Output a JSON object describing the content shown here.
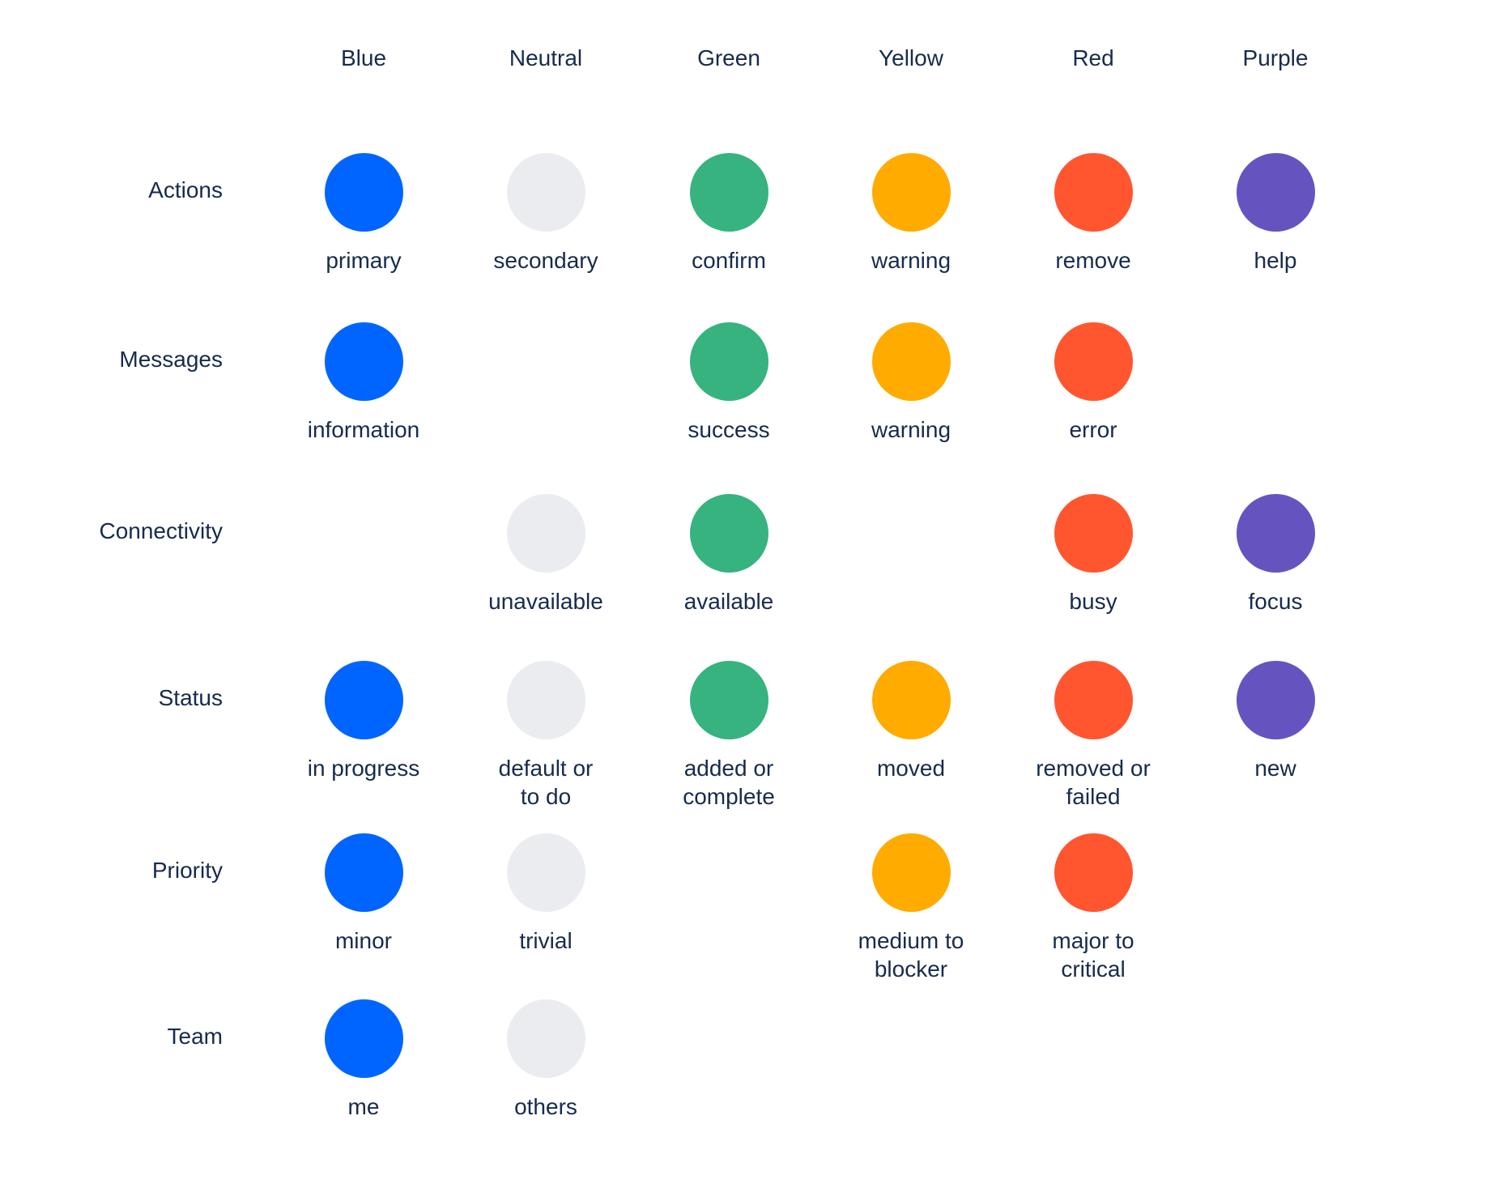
{
  "colors": {
    "blue": "#0065ff",
    "neutral": "#ebecf0",
    "green": "#36b37e",
    "yellow": "#ffab00",
    "red": "#ff5630",
    "purple": "#6554c0"
  },
  "columns": [
    "Blue",
    "Neutral",
    "Green",
    "Yellow",
    "Red",
    "Purple"
  ],
  "rows": [
    {
      "label": "Actions",
      "cells": [
        {
          "col": 0,
          "color": "blue",
          "label": "primary"
        },
        {
          "col": 1,
          "color": "neutral",
          "label": "secondary"
        },
        {
          "col": 2,
          "color": "green",
          "label": "confirm"
        },
        {
          "col": 3,
          "color": "yellow",
          "label": "warning"
        },
        {
          "col": 4,
          "color": "red",
          "label": "remove"
        },
        {
          "col": 5,
          "color": "purple",
          "label": "help"
        }
      ]
    },
    {
      "label": "Messages",
      "cells": [
        {
          "col": 0,
          "color": "blue",
          "label": "information"
        },
        {
          "col": 2,
          "color": "green",
          "label": "success"
        },
        {
          "col": 3,
          "color": "yellow",
          "label": "warning"
        },
        {
          "col": 4,
          "color": "red",
          "label": "error"
        }
      ]
    },
    {
      "label": "Connectivity",
      "cells": [
        {
          "col": 1,
          "color": "neutral",
          "label": "unavailable"
        },
        {
          "col": 2,
          "color": "green",
          "label": "available"
        },
        {
          "col": 4,
          "color": "red",
          "label": "busy"
        },
        {
          "col": 5,
          "color": "purple",
          "label": "focus"
        }
      ]
    },
    {
      "label": "Status",
      "cells": [
        {
          "col": 0,
          "color": "blue",
          "label": "in progress"
        },
        {
          "col": 1,
          "color": "neutral",
          "label": "default or\nto do"
        },
        {
          "col": 2,
          "color": "green",
          "label": "added or\ncomplete"
        },
        {
          "col": 3,
          "color": "yellow",
          "label": "moved"
        },
        {
          "col": 4,
          "color": "red",
          "label": "removed or\nfailed"
        },
        {
          "col": 5,
          "color": "purple",
          "label": "new"
        }
      ]
    },
    {
      "label": "Priority",
      "cells": [
        {
          "col": 0,
          "color": "blue",
          "label": "minor"
        },
        {
          "col": 1,
          "color": "neutral",
          "label": "trivial"
        },
        {
          "col": 3,
          "color": "yellow",
          "label": "medium to\nblocker"
        },
        {
          "col": 4,
          "color": "red",
          "label": "major to\ncritical"
        }
      ]
    },
    {
      "label": "Team",
      "cells": [
        {
          "col": 0,
          "color": "blue",
          "label": "me"
        },
        {
          "col": 1,
          "color": "neutral",
          "label": "others"
        }
      ]
    }
  ]
}
